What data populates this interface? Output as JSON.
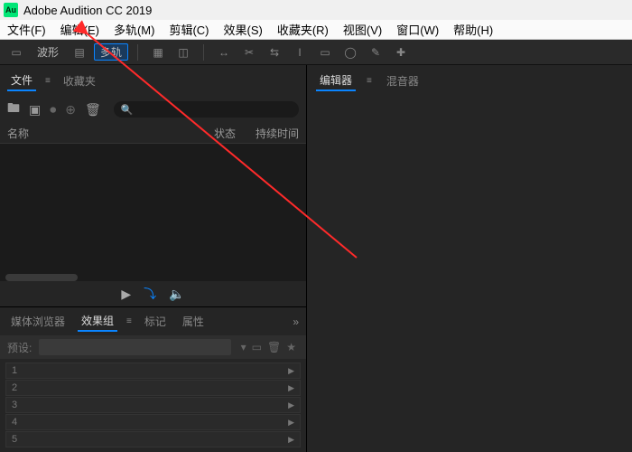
{
  "app": {
    "icon": "Au",
    "title": "Adobe Audition CC 2019"
  },
  "menu": [
    "文件(F)",
    "编辑(E)",
    "多轨(M)",
    "剪辑(C)",
    "效果(S)",
    "收藏夹(R)",
    "视图(V)",
    "窗口(W)",
    "帮助(H)"
  ],
  "toolbar": {
    "waveform": "波形",
    "multitrack": "多轨"
  },
  "filesPanel": {
    "tabs": {
      "files": "文件",
      "favorites": "收藏夹"
    },
    "cols": {
      "name": "名称",
      "status": "状态",
      "duration": "持续时间"
    },
    "search": ""
  },
  "lower": {
    "tabs": {
      "media": "媒体浏览器",
      "fxgroup": "效果组",
      "markers": "标记",
      "props": "属性"
    },
    "preset": "预设:",
    "slots": [
      1,
      2,
      3,
      4,
      5
    ]
  },
  "editor": {
    "tabs": {
      "editor": "编辑器",
      "mixer": "混音器"
    }
  },
  "arrow": {
    "color": "#ff2a2a"
  }
}
